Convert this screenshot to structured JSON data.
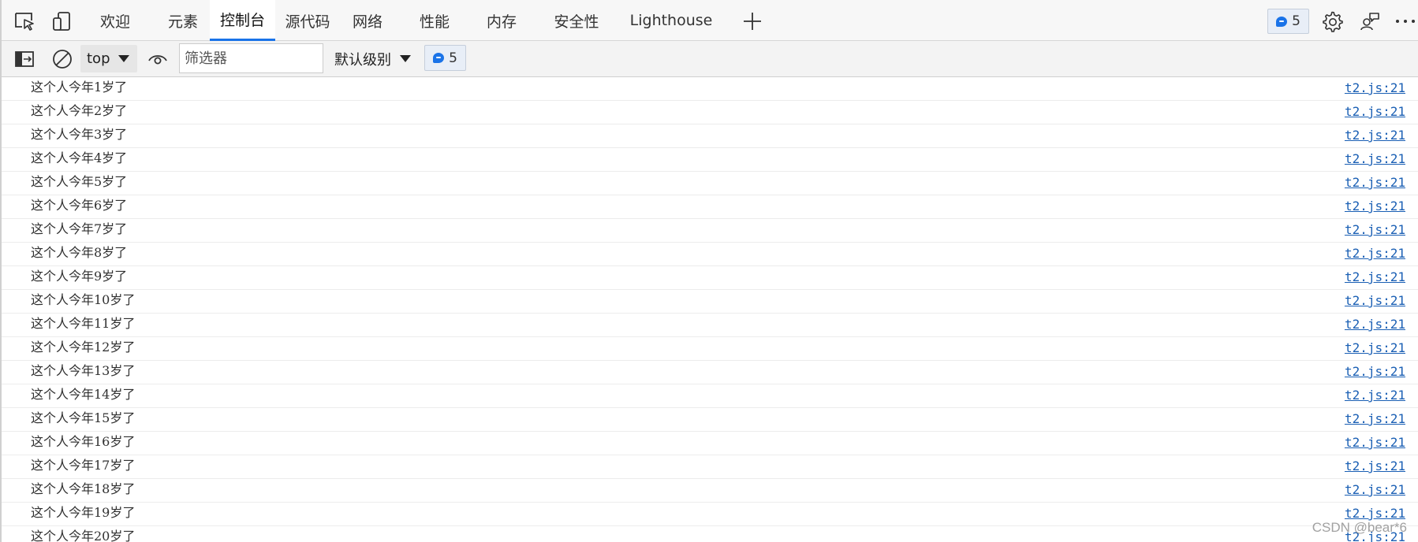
{
  "tabs": [
    {
      "label": "欢迎",
      "active": false
    },
    {
      "label": "元素",
      "active": false
    },
    {
      "label": "控制台",
      "active": true
    },
    {
      "label": "源代码",
      "active": false
    },
    {
      "label": "网络",
      "active": false
    },
    {
      "label": "性能",
      "active": false
    },
    {
      "label": "内存",
      "active": false
    },
    {
      "label": "安全性",
      "active": false
    },
    {
      "label": "Lighthouse",
      "active": false
    }
  ],
  "header": {
    "message_count": "5"
  },
  "toolbar": {
    "context": "top",
    "filter_placeholder": "筛选器",
    "filter_value": "",
    "log_level": "默认级别",
    "message_count": "5"
  },
  "logs": [
    {
      "text": "这个人今年1岁了",
      "source": "t2.js:21"
    },
    {
      "text": "这个人今年2岁了",
      "source": "t2.js:21"
    },
    {
      "text": "这个人今年3岁了",
      "source": "t2.js:21"
    },
    {
      "text": "这个人今年4岁了",
      "source": "t2.js:21"
    },
    {
      "text": "这个人今年5岁了",
      "source": "t2.js:21"
    },
    {
      "text": "这个人今年6岁了",
      "source": "t2.js:21"
    },
    {
      "text": "这个人今年7岁了",
      "source": "t2.js:21"
    },
    {
      "text": "这个人今年8岁了",
      "source": "t2.js:21"
    },
    {
      "text": "这个人今年9岁了",
      "source": "t2.js:21"
    },
    {
      "text": "这个人今年10岁了",
      "source": "t2.js:21"
    },
    {
      "text": "这个人今年11岁了",
      "source": "t2.js:21"
    },
    {
      "text": "这个人今年12岁了",
      "source": "t2.js:21"
    },
    {
      "text": "这个人今年13岁了",
      "source": "t2.js:21"
    },
    {
      "text": "这个人今年14岁了",
      "source": "t2.js:21"
    },
    {
      "text": "这个人今年15岁了",
      "source": "t2.js:21"
    },
    {
      "text": "这个人今年16岁了",
      "source": "t2.js:21"
    },
    {
      "text": "这个人今年17岁了",
      "source": "t2.js:21"
    },
    {
      "text": "这个人今年18岁了",
      "source": "t2.js:21"
    },
    {
      "text": "这个人今年19岁了",
      "source": "t2.js:21"
    },
    {
      "text": "这个人今年20岁了",
      "source": "t2.js:21"
    }
  ],
  "watermark": "CSDN @bear*6",
  "colors": {
    "accent": "#1a73e8",
    "link": "#1a5fb4"
  }
}
